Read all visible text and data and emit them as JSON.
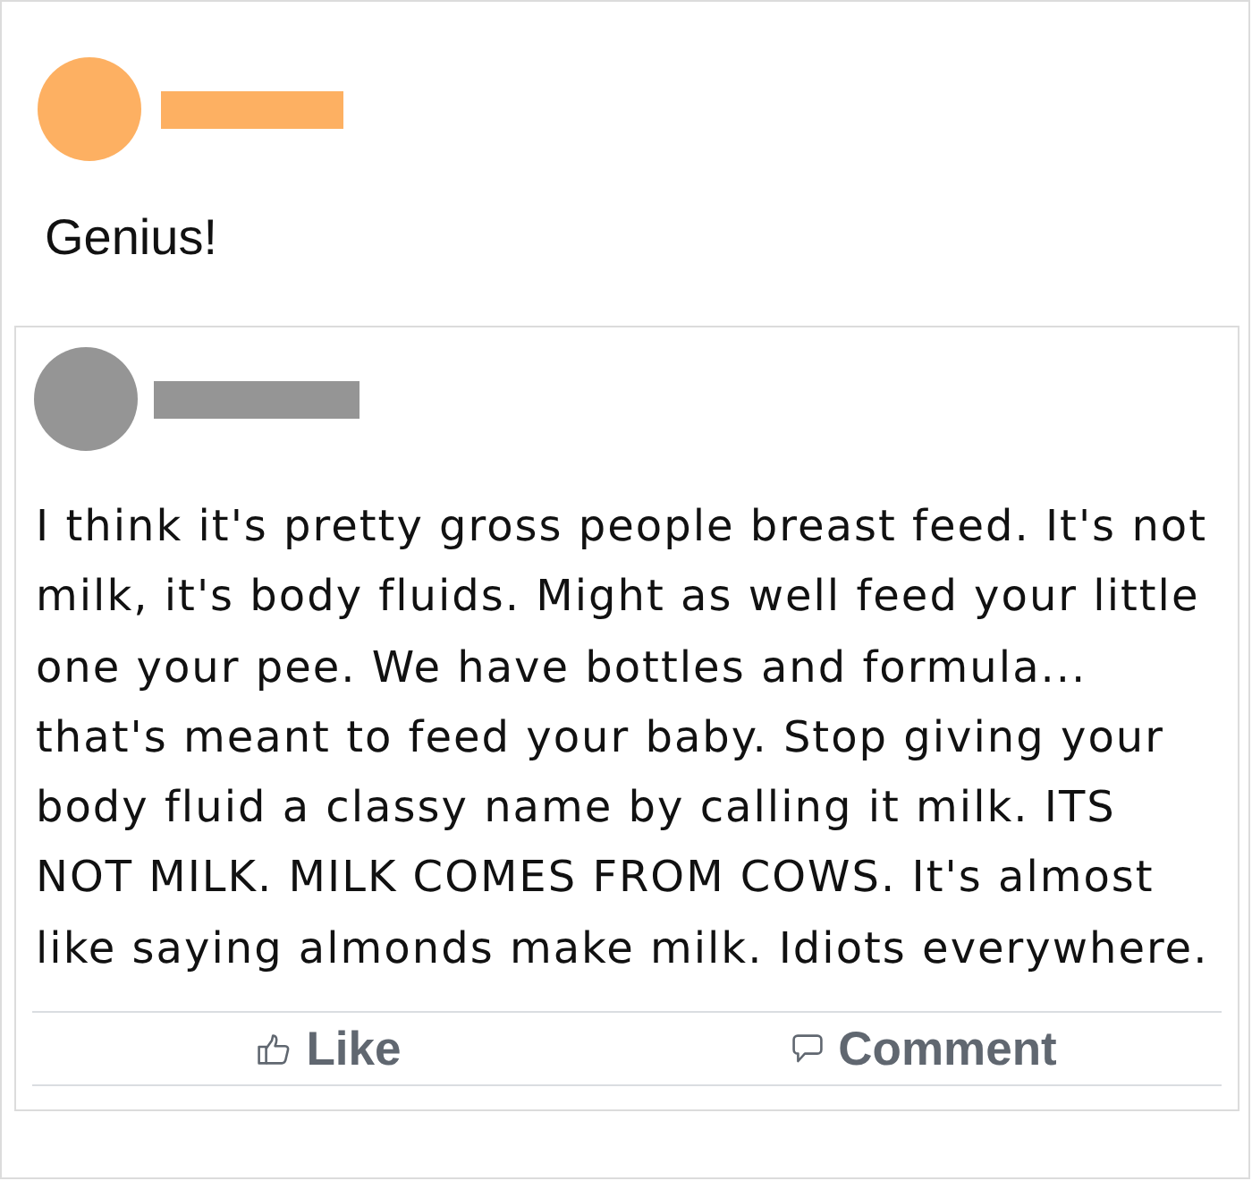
{
  "post": {
    "text": "Genius!"
  },
  "shared_post": {
    "text": "I think it's pretty gross people breast feed. It's not milk, it's body fluids. Might as well feed your little one your pee. We have bottles and formula... that's meant to feed your baby. Stop giving your body fluid a classy name by calling it milk. ITS NOT MILK. MILK COMES FROM COWS. It's almost like saying almonds make milk. Idiots everywhere."
  },
  "actions": [
    {
      "kind": "like",
      "label": "Like"
    },
    {
      "kind": "comment",
      "label": "Comment"
    }
  ]
}
